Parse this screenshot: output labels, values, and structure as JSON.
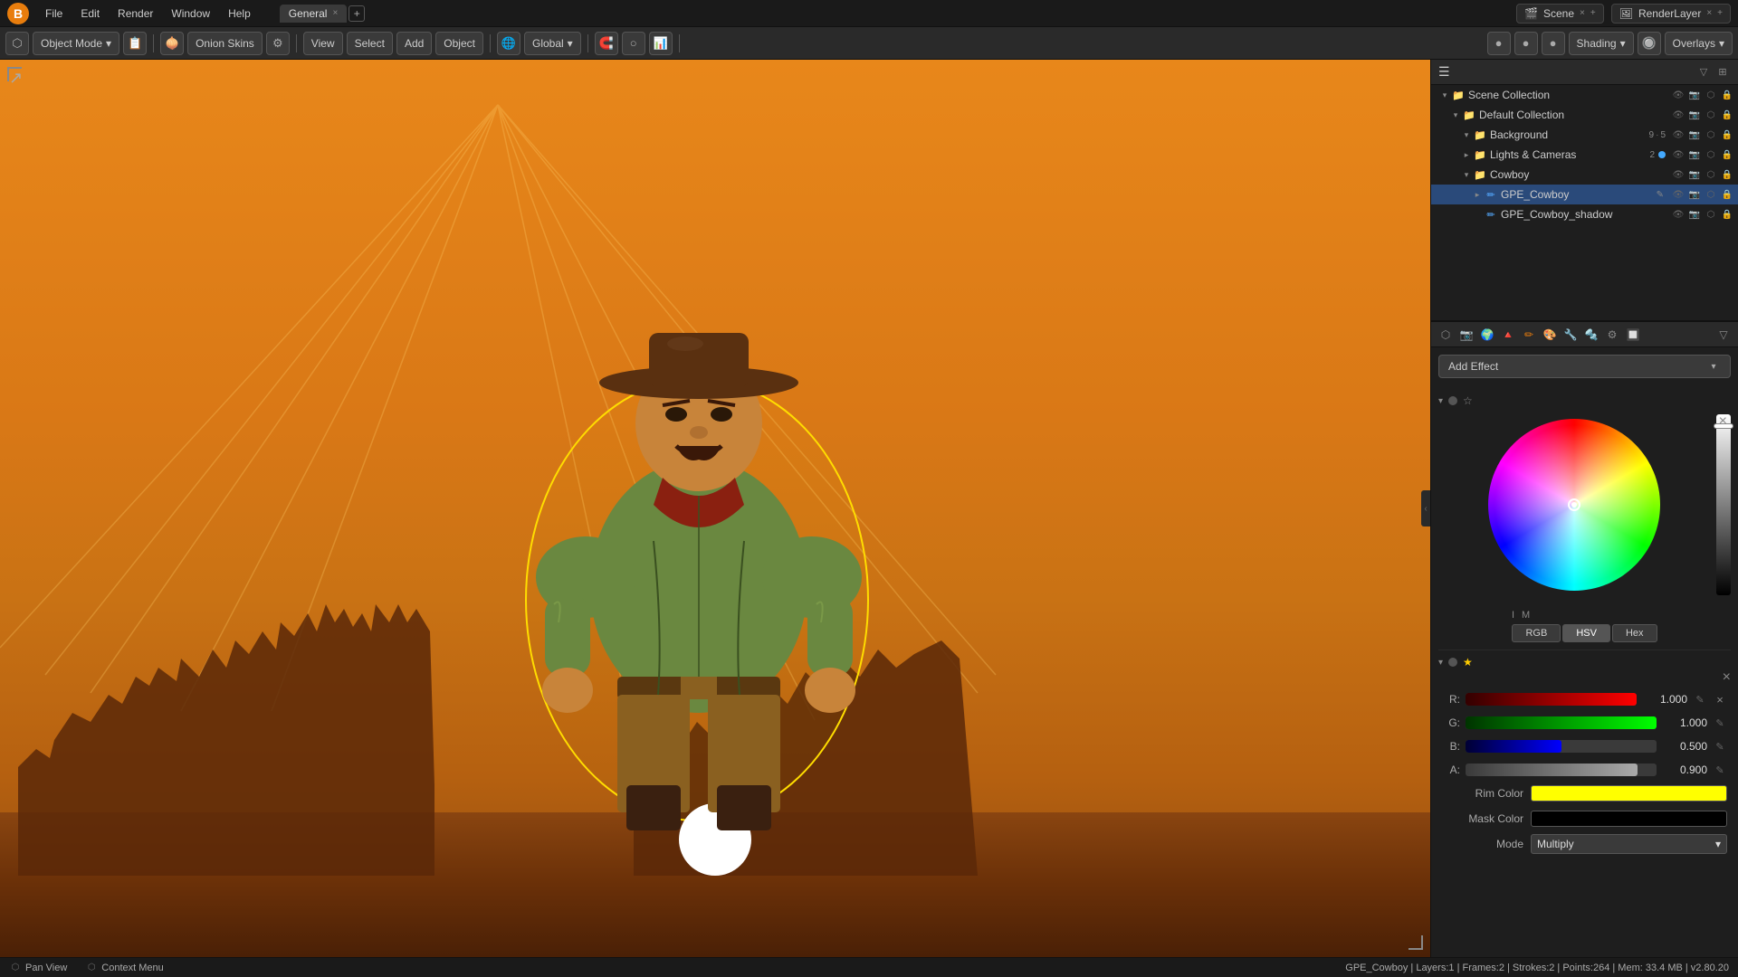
{
  "app": {
    "icon": "B",
    "tabs": [
      {
        "label": "General",
        "active": true
      },
      {
        "label": "+",
        "add": true
      }
    ],
    "menu": [
      "File",
      "Edit",
      "Render",
      "Window",
      "Help"
    ]
  },
  "toolbar": {
    "mode_icon": "⬡",
    "mode_label": "Object Mode",
    "mode_arrow": "▾",
    "onion_skins_label": "Onion Skins",
    "view_label": "View",
    "select_label": "Select",
    "add_label": "Add",
    "object_label": "Object",
    "global_label": "Global",
    "shading_label": "Shading",
    "overlays_label": "Overlays"
  },
  "header_right": {
    "scene_icon": "🎬",
    "scene_label": "Scene",
    "render_icon": "🖼",
    "render_label": "RenderLayer"
  },
  "outliner": {
    "title_icon": "☰",
    "filter_icon": "🔽",
    "items": [
      {
        "id": "scene-collection",
        "indent": 0,
        "expand": "▾",
        "icon": "📁",
        "icon_color": "#e87d0d",
        "label": "Scene Collection",
        "visible": true,
        "lock": false
      },
      {
        "id": "default-collection",
        "indent": 1,
        "expand": "▾",
        "icon": "📁",
        "icon_color": "#888",
        "label": "Default Collection",
        "visible": true,
        "lock": false
      },
      {
        "id": "background",
        "indent": 2,
        "expand": "▾",
        "icon": "📁",
        "icon_color": "#888",
        "label": "Background",
        "num1": "9",
        "num2": "5",
        "visible": true,
        "lock": false
      },
      {
        "id": "lights-cameras",
        "indent": 2,
        "expand": "▸",
        "icon": "📁",
        "icon_color": "#888",
        "label": "Lights & Cameras",
        "num1": "2",
        "num2": "",
        "dot_color": "#4af",
        "visible": true,
        "lock": false
      },
      {
        "id": "cowboy",
        "indent": 2,
        "expand": "▾",
        "icon": "📁",
        "icon_color": "#888",
        "label": "Cowboy",
        "visible": true,
        "lock": false
      },
      {
        "id": "gpe-cowboy",
        "indent": 3,
        "expand": "▸",
        "icon": "✏",
        "icon_color": "#5af",
        "label": "GPE_Cowboy",
        "has_edit": true,
        "visible": true,
        "lock": false
      },
      {
        "id": "gpe-cowboy-shadow",
        "indent": 3,
        "expand": "",
        "icon": "✏",
        "icon_color": "#5af",
        "label": "GPE_Cowboy_shadow",
        "visible": true,
        "lock": false
      }
    ]
  },
  "properties": {
    "toolbar_icons": [
      "⬡",
      "📷",
      "🌍",
      "🔺",
      "✏",
      "🎨",
      "🔧",
      "🔩",
      "⚙",
      "🔲"
    ],
    "add_effect_label": "Add Effect",
    "effect1": {
      "arrow": "▾",
      "star": "★",
      "star_active": false
    },
    "effect2": {
      "arrow": "▾",
      "star": "★",
      "star_active": true
    }
  },
  "color_picker": {
    "close_label": "×",
    "modes": [
      "RGB",
      "HSV",
      "Hex"
    ],
    "active_mode": "RGB",
    "channels": [
      {
        "label": "R:",
        "value": "1.000",
        "fill_color": "#ff3333",
        "fill_pct": 100
      },
      {
        "label": "G:",
        "value": "1.000",
        "fill_color": "#33ff33",
        "fill_pct": 100
      },
      {
        "label": "B:",
        "value": "0.500",
        "fill_color": "#3333ff",
        "fill_pct": 50
      },
      {
        "label": "A:",
        "value": "0.900",
        "fill_color": "#aaaaaa",
        "fill_pct": 90
      }
    ],
    "rim_color_label": "Rim Color",
    "rim_color_swatch": "#ffff00",
    "mask_color_label": "Mask Color",
    "mask_color_swatch": "#000000",
    "mode_label": "Mode",
    "mode_value": "Multiply",
    "mode_arrow": "▾"
  },
  "status_bar": {
    "left_icon1": "⬡",
    "left_label1": "Pan View",
    "left_icon2": "⬡",
    "left_label2": "Context Menu",
    "info": "GPE_Cowboy | Layers:1 | Frames:2 | Strokes:2 | Points:264 | Mem: 33.4 MB | v2.80.20"
  }
}
